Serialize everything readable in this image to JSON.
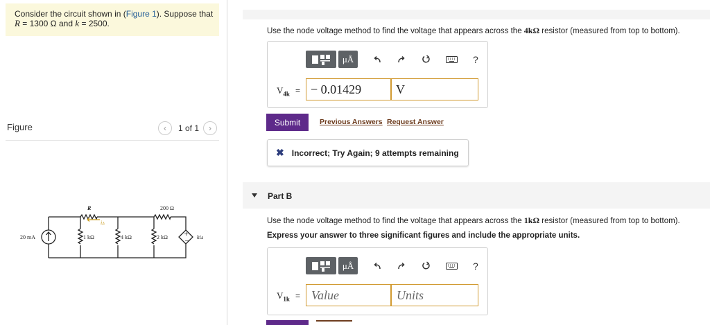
{
  "intro": {
    "line1_pre": "Consider the circuit shown in (",
    "figure_link": "Figure 1",
    "line1_post": "). Suppose that",
    "r_var": "R",
    "r_eq": " = 1300  ",
    "ohm": "Ω",
    "and_text": " and ",
    "k_var": "k",
    "k_eq": " = 2500."
  },
  "figure": {
    "label": "Figure",
    "pager": {
      "prev_icon": "chevron-left-icon",
      "next_icon": "chevron-right-icon",
      "count": "1 of 1"
    }
  },
  "circuit": {
    "source_label": "20 mA",
    "r_label": "R",
    "r200_label": "200 Ω",
    "r1k_label": "1 kΩ",
    "r4k_label": "4 kΩ",
    "r2k_label": "2 kΩ",
    "current_label": "i",
    "current_sub": "Δ",
    "dep_label": "ki",
    "dep_sub": "Δ"
  },
  "partA": {
    "question_pre": "Use the node voltage method to find the voltage that appears across the ",
    "question_math": "4kΩ",
    "question_post": " resistor (measured from top to bottom).",
    "toolbar": {
      "units_label": "μÅ",
      "help_label": "?"
    },
    "var_main": "V",
    "var_sub": "4k",
    "equals": "=",
    "value": "− 0.01429",
    "units": "V",
    "submit_label": "Submit",
    "previous_answers": "Previous Answers",
    "request_answer": "Request Answer",
    "feedback": "Incorrect; Try Again; 9 attempts remaining"
  },
  "partB": {
    "title": "Part B",
    "question_pre": "Use the node voltage method to find the voltage that appears across the ",
    "question_math": "1kΩ",
    "question_post": " resistor (measured from top to bottom).",
    "instruction": "Express your answer to three significant figures and include the appropriate units.",
    "toolbar": {
      "units_label": "μÅ",
      "help_label": "?"
    },
    "var_main": "V",
    "var_sub": "1k",
    "equals": "=",
    "value_placeholder": "Value",
    "units_placeholder": "Units"
  },
  "colors": {
    "intro_bg": "#fbf8dc",
    "submit_bg": "#5e2a8a",
    "field_border": "#d19a31",
    "toolbar_btn": "#5d6165",
    "link": "#6e3d1f",
    "feedback_icon": "#2d3d7c"
  }
}
